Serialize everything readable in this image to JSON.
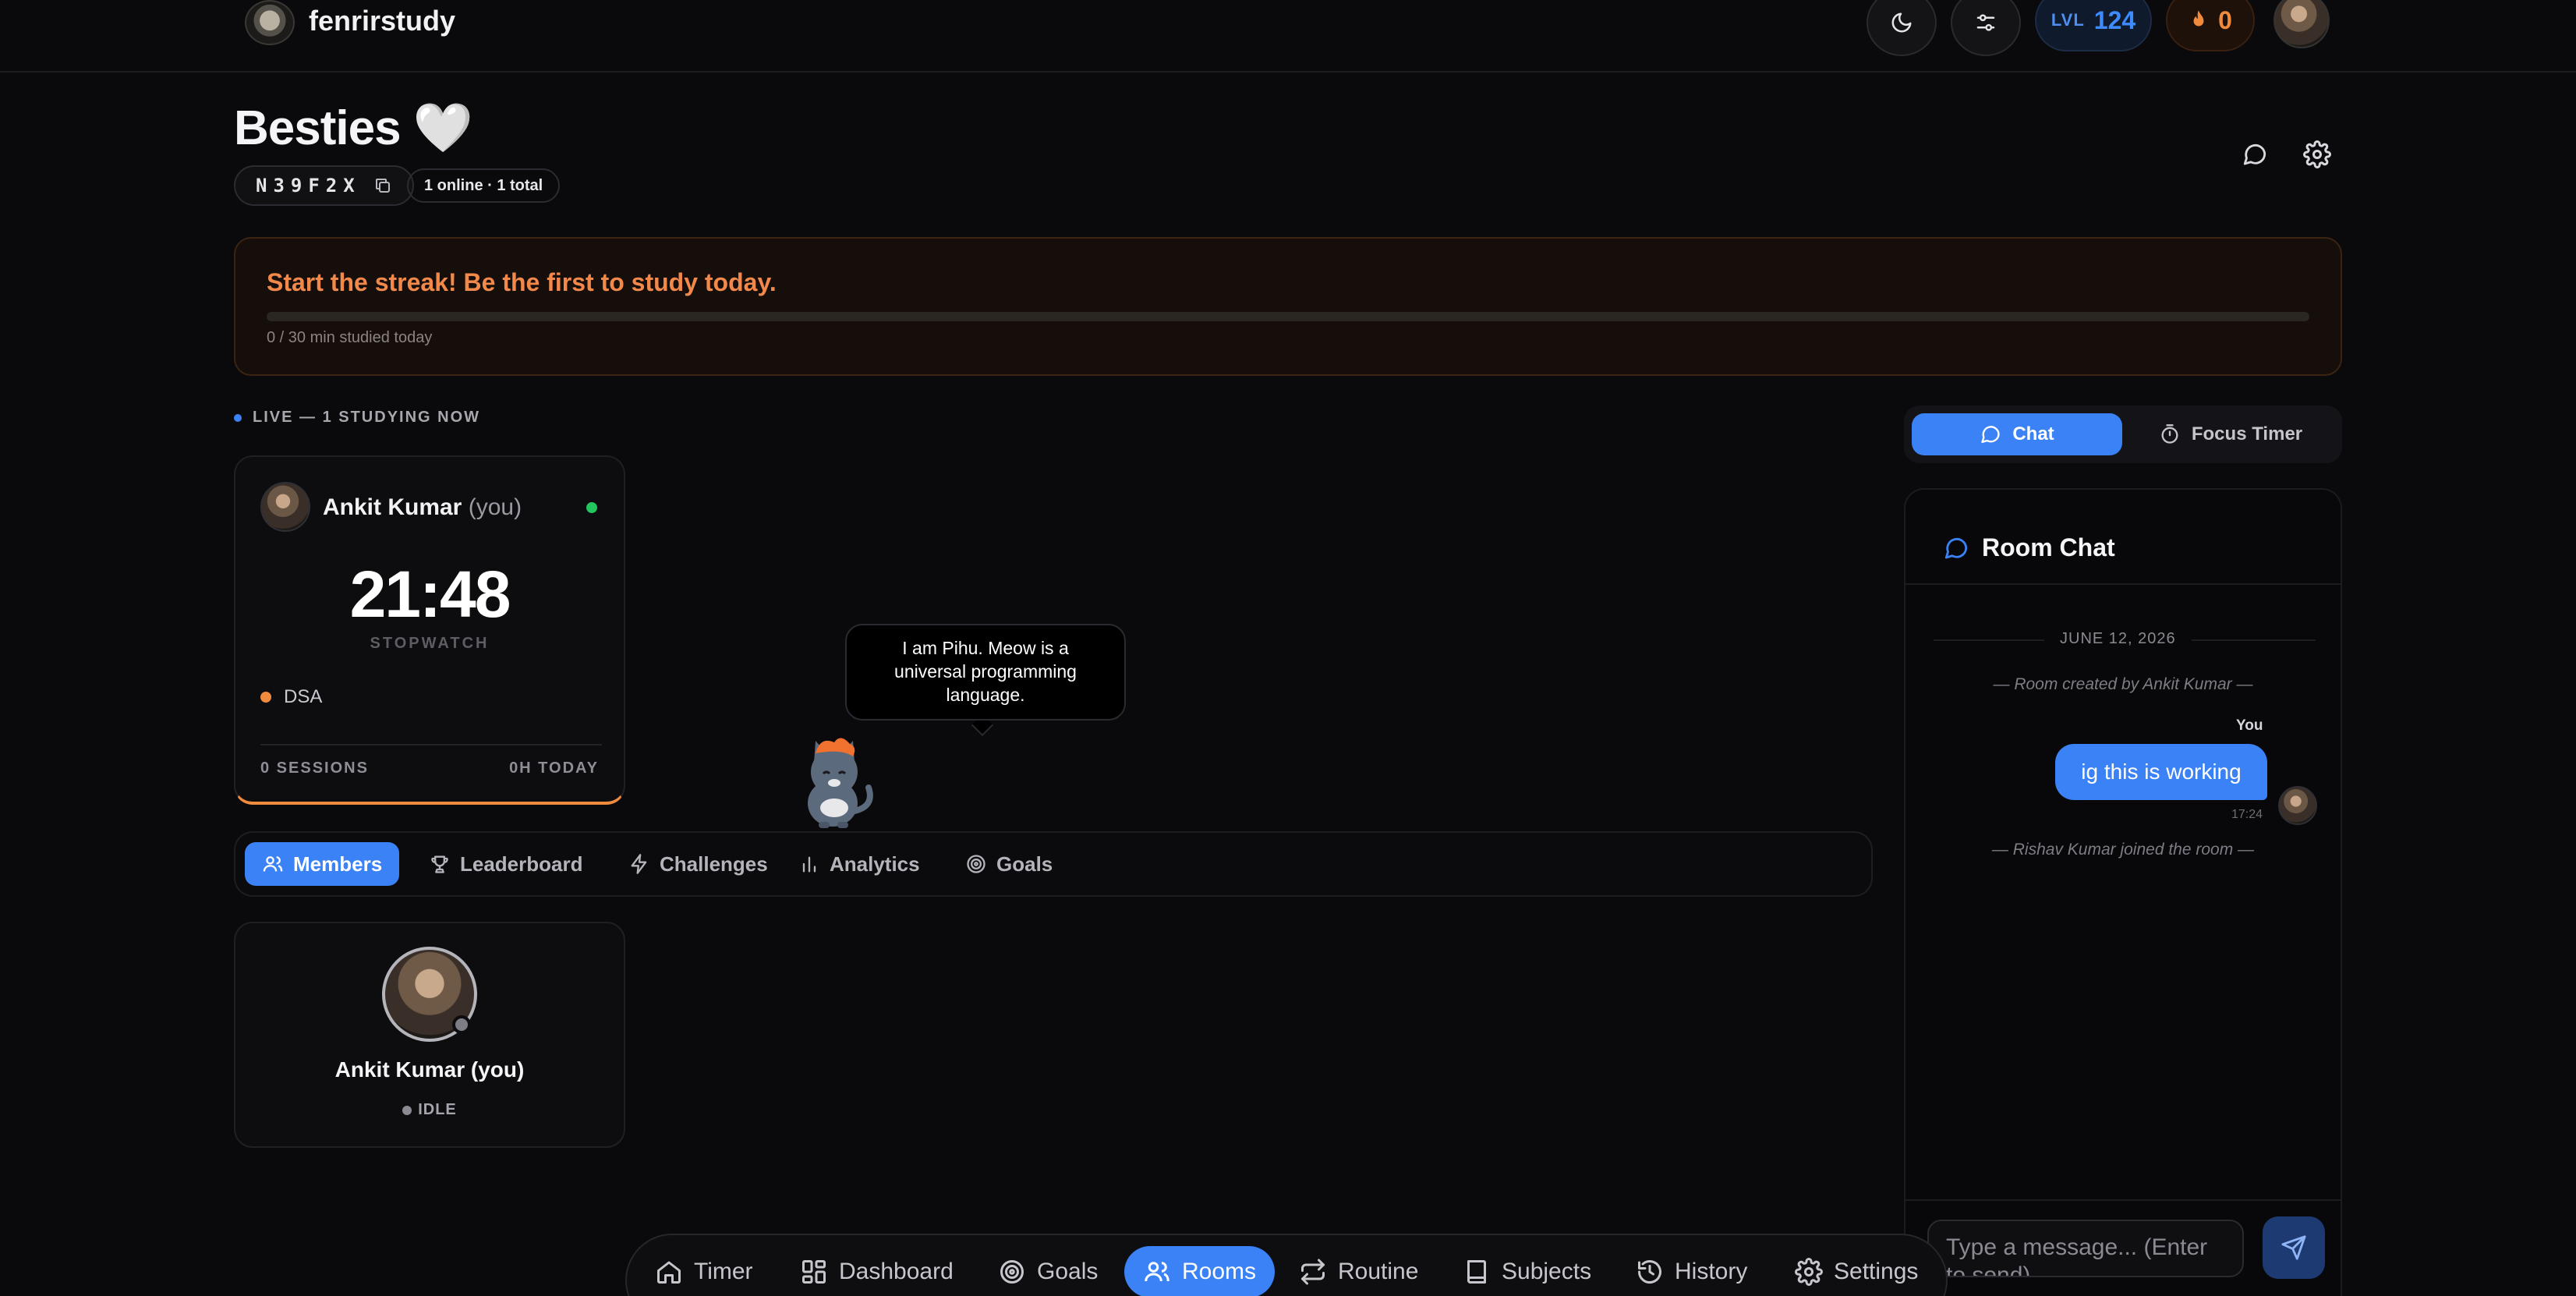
{
  "app": {
    "brand": "fenrirstudy",
    "level_label": "LVL",
    "level": "124",
    "streak_count": "0"
  },
  "room": {
    "title": "Besties 🤍",
    "code": "N39F2X",
    "presence": "1 online · 1 total"
  },
  "streak_banner": {
    "title": "Start the streak! Be the first to study today.",
    "progress_text": "0 / 30 min studied today",
    "progress_fraction": 0
  },
  "live": {
    "label": "LIVE — 1 STUDYING NOW",
    "card": {
      "name": "Ankit Kumar",
      "you": "(you)",
      "time": "21:48",
      "mode": "STOPWATCH",
      "subject": "DSA",
      "sessions": "0 SESSIONS",
      "today": "0H TODAY"
    }
  },
  "mascot": {
    "speech": "I am Pihu. Meow is a universal programming language."
  },
  "tabs": [
    {
      "label": "Members",
      "icon": "users-icon",
      "active": true
    },
    {
      "label": "Leaderboard",
      "icon": "trophy-icon"
    },
    {
      "label": "Challenges",
      "icon": "bolt-icon"
    },
    {
      "label": "Analytics",
      "icon": "bar-chart-icon"
    },
    {
      "label": "Goals",
      "icon": "target-icon"
    }
  ],
  "member": {
    "name": "Ankit Kumar (you)",
    "status": "IDLE"
  },
  "right_panel": {
    "seg_chat": "Chat",
    "seg_timer": "Focus Timer",
    "chat_title": "Room Chat",
    "date": "JUNE 12, 2026",
    "system_created": "— Room created by Ankit Kumar —",
    "you_label": "You",
    "message": "ig this is working",
    "message_time": "17:24",
    "system_joined": "— Rishav Kumar joined the room —",
    "input_placeholder": "Type a message... (Enter to send)"
  },
  "bottom_nav": [
    {
      "label": "Timer",
      "icon": "home-icon"
    },
    {
      "label": "Dashboard",
      "icon": "dashboard-icon"
    },
    {
      "label": "Goals",
      "icon": "target-icon"
    },
    {
      "label": "Rooms",
      "icon": "users-icon",
      "active": true
    },
    {
      "label": "Routine",
      "icon": "repeat-icon"
    },
    {
      "label": "Subjects",
      "icon": "book-icon"
    },
    {
      "label": "History",
      "icon": "history-icon"
    },
    {
      "label": "Settings",
      "icon": "gear-icon"
    }
  ],
  "colors": {
    "accent": "#3b82f6",
    "streak": "#f2894a",
    "online": "#22c55e",
    "background": "#0a0a0c"
  }
}
